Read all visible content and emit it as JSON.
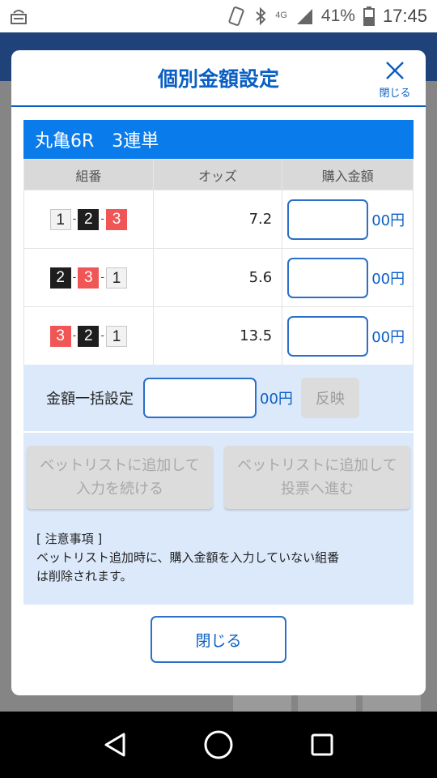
{
  "status_bar": {
    "battery_percent": "41%",
    "time": "17:45",
    "network": "4G"
  },
  "modal": {
    "title": "個別金額設定",
    "close_x_label": "閉じる",
    "race_label": "丸亀6R　3連単",
    "table": {
      "headers": [
        "組番",
        "オッズ",
        "購入金額"
      ],
      "rows": [
        {
          "combo": [
            {
              "num": "1",
              "color": "white"
            },
            {
              "num": "2",
              "color": "black"
            },
            {
              "num": "3",
              "color": "red"
            }
          ],
          "odds": "7.2",
          "amount": "",
          "unit": "00円"
        },
        {
          "combo": [
            {
              "num": "2",
              "color": "black"
            },
            {
              "num": "3",
              "color": "red"
            },
            {
              "num": "1",
              "color": "white"
            }
          ],
          "odds": "5.6",
          "amount": "",
          "unit": "00円"
        },
        {
          "combo": [
            {
              "num": "3",
              "color": "red"
            },
            {
              "num": "2",
              "color": "black"
            },
            {
              "num": "1",
              "color": "white"
            }
          ],
          "odds": "13.5",
          "amount": "",
          "unit": "00円"
        }
      ]
    },
    "bulk": {
      "label": "金額一括設定",
      "value": "",
      "unit": "00円",
      "reflect_label": "反映"
    },
    "add_continue": {
      "line1": "ベットリストに追加して",
      "line2": "入力を続ける"
    },
    "add_vote": {
      "line1": "ベットリストに追加して",
      "line2": "投票へ進む"
    },
    "notes": {
      "heading": "[ 注意事項 ]",
      "line1": "ベットリスト追加時に、購入金額を入力していない組番",
      "line2": "は削除されます。"
    },
    "close_button_label": "閉じる"
  },
  "colors": {
    "accent": "#0a5fc4",
    "race_bar": "#0a7bea",
    "panel": "#dce9fb",
    "boat_red": "#f05656",
    "boat_black": "#1e1e1e"
  }
}
